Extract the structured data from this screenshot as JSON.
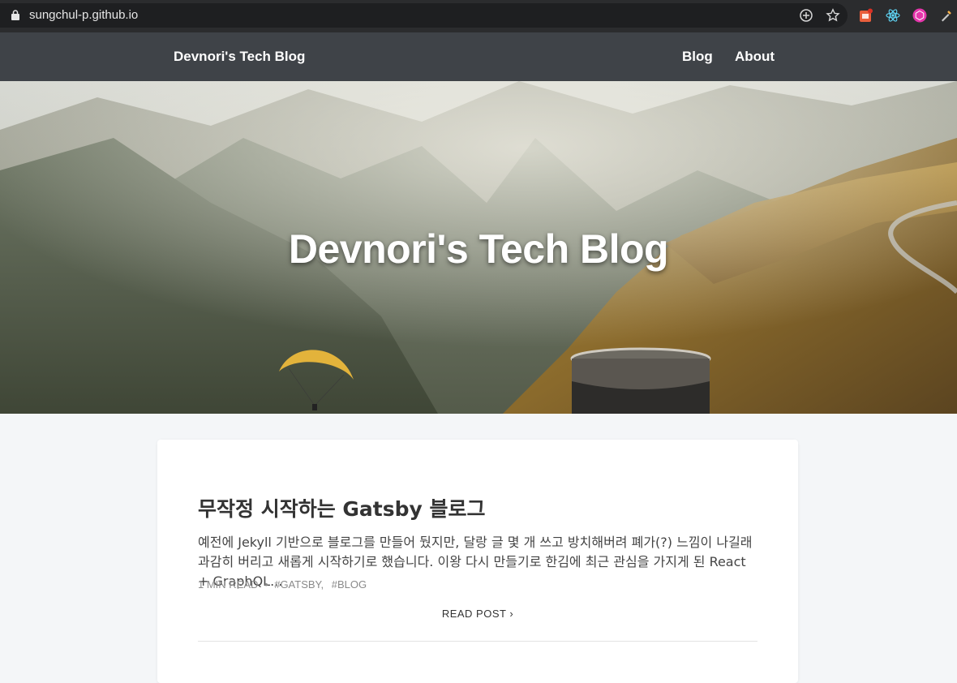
{
  "browser": {
    "url": "sungchul-p.github.io",
    "icons": [
      "lock-icon",
      "add-icon",
      "bookmark-star-icon",
      "extension-badge-icon",
      "react-devtools-icon",
      "graphql-extension-icon",
      "color-picker-icon"
    ]
  },
  "nav": {
    "brand": "Devnori's Tech Blog",
    "links": [
      "Blog",
      "About"
    ]
  },
  "hero": {
    "title": "Devnori's Tech Blog"
  },
  "post": {
    "title": "무작정 시작하는 Gatsby 블로그",
    "excerpt": "예전에 Jekyll 기반으로 블로그를 만들어 뒀지만, 달랑 글 몇 개 쓰고 방치해버려 폐가(?) 느낌이 나길래 과감히 버리고 새롭게 시작하기로 했습니다. 이왕 다시 만들기로 한김에 최근 관심을 가지게 된 React + GraphQL...",
    "read_time": "1 MIN READ",
    "meta_separator": "•",
    "tags": [
      "#GATSBY,",
      "#BLOG"
    ],
    "read_more": "READ POST ›"
  },
  "colors": {
    "nav_bg": "#3f4348",
    "browser_bg": "#2b2c2e",
    "page_bg": "#f4f6f8"
  }
}
